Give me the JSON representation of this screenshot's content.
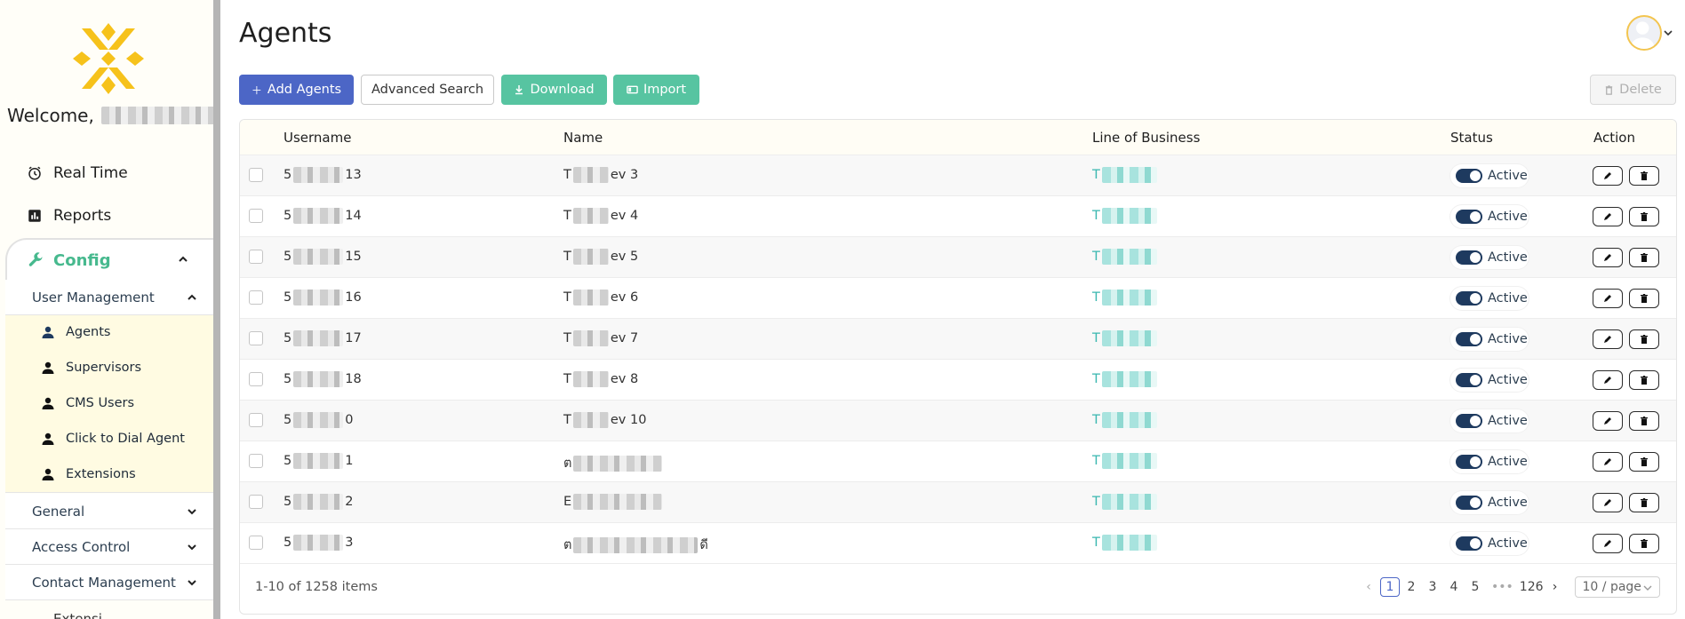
{
  "page": {
    "title": "Agents"
  },
  "sidebar": {
    "welcome": "Welcome,",
    "nav": [
      {
        "label": "Real Time",
        "icon": "alarm-clock-icon"
      },
      {
        "label": "Reports",
        "icon": "bar-chart-icon"
      }
    ],
    "config": {
      "label": "Config",
      "icon": "wrench-icon",
      "accent": "#47b98e"
    },
    "user_management": {
      "label": "User Management",
      "items": [
        {
          "label": "Agents",
          "icon": "user-icon"
        },
        {
          "label": "Supervisors",
          "icon": "user-icon"
        },
        {
          "label": "CMS Users",
          "icon": "user-icon"
        },
        {
          "label": "Click to Dial Agent",
          "icon": "user-icon"
        },
        {
          "label": "Extensions",
          "icon": "user-icon"
        }
      ]
    },
    "sections": [
      {
        "label": "General"
      },
      {
        "label": "Access Control"
      },
      {
        "label": "Contact Management"
      }
    ],
    "bottom_peek": "Extensi"
  },
  "toolbar": {
    "add_label": "Add Agents",
    "advanced_search_label": "Advanced Search",
    "download_label": "Download",
    "import_label": "Import",
    "delete_label": "Delete"
  },
  "table": {
    "columns": {
      "username": "Username",
      "name": "Name",
      "lob": "Line of Business",
      "status": "Status",
      "action": "Action"
    },
    "rows": [
      {
        "user_prefix": "5",
        "user_suffix": "13",
        "name_prefix": "T",
        "name_suffix": "ev 3",
        "lob_prefix": "T",
        "status": "Active"
      },
      {
        "user_prefix": "5",
        "user_suffix": "14",
        "name_prefix": "T",
        "name_suffix": "ev 4",
        "lob_prefix": "T",
        "status": "Active"
      },
      {
        "user_prefix": "5",
        "user_suffix": "15",
        "name_prefix": "T",
        "name_suffix": "ev 5",
        "lob_prefix": "T",
        "status": "Active"
      },
      {
        "user_prefix": "5",
        "user_suffix": "16",
        "name_prefix": "T",
        "name_suffix": "ev 6",
        "lob_prefix": "T",
        "status": "Active"
      },
      {
        "user_prefix": "5",
        "user_suffix": "17",
        "name_prefix": "T",
        "name_suffix": "ev 7",
        "lob_prefix": "T",
        "status": "Active"
      },
      {
        "user_prefix": "5",
        "user_suffix": "18",
        "name_prefix": "T",
        "name_suffix": "ev 8",
        "lob_prefix": "T",
        "status": "Active"
      },
      {
        "user_prefix": "5",
        "user_suffix": "0",
        "name_prefix": "T",
        "name_suffix": "ev 10",
        "lob_prefix": "T",
        "status": "Active"
      },
      {
        "user_prefix": "5",
        "user_suffix": "1",
        "name_prefix": "ต",
        "name_suffix": "",
        "lob_prefix": "T",
        "status": "Active"
      },
      {
        "user_prefix": "5",
        "user_suffix": "2",
        "name_prefix": "E",
        "name_suffix": "",
        "lob_prefix": "T",
        "status": "Active"
      },
      {
        "user_prefix": "5",
        "user_suffix": "3",
        "name_prefix": "ต",
        "name_suffix": "ดี",
        "lob_prefix": "T",
        "status": "Active"
      }
    ]
  },
  "pagination": {
    "summary": "1-10 of 1258 items",
    "pages": [
      "1",
      "2",
      "3",
      "4",
      "5"
    ],
    "ellipsis": "•••",
    "last_page": "126",
    "page_size": "10 / page",
    "current": "1"
  },
  "colors": {
    "primary": "#4c66c6",
    "green": "#57c4a1",
    "lob_text": "#3ab7b0",
    "toggle_on": "#1e3a5f"
  }
}
